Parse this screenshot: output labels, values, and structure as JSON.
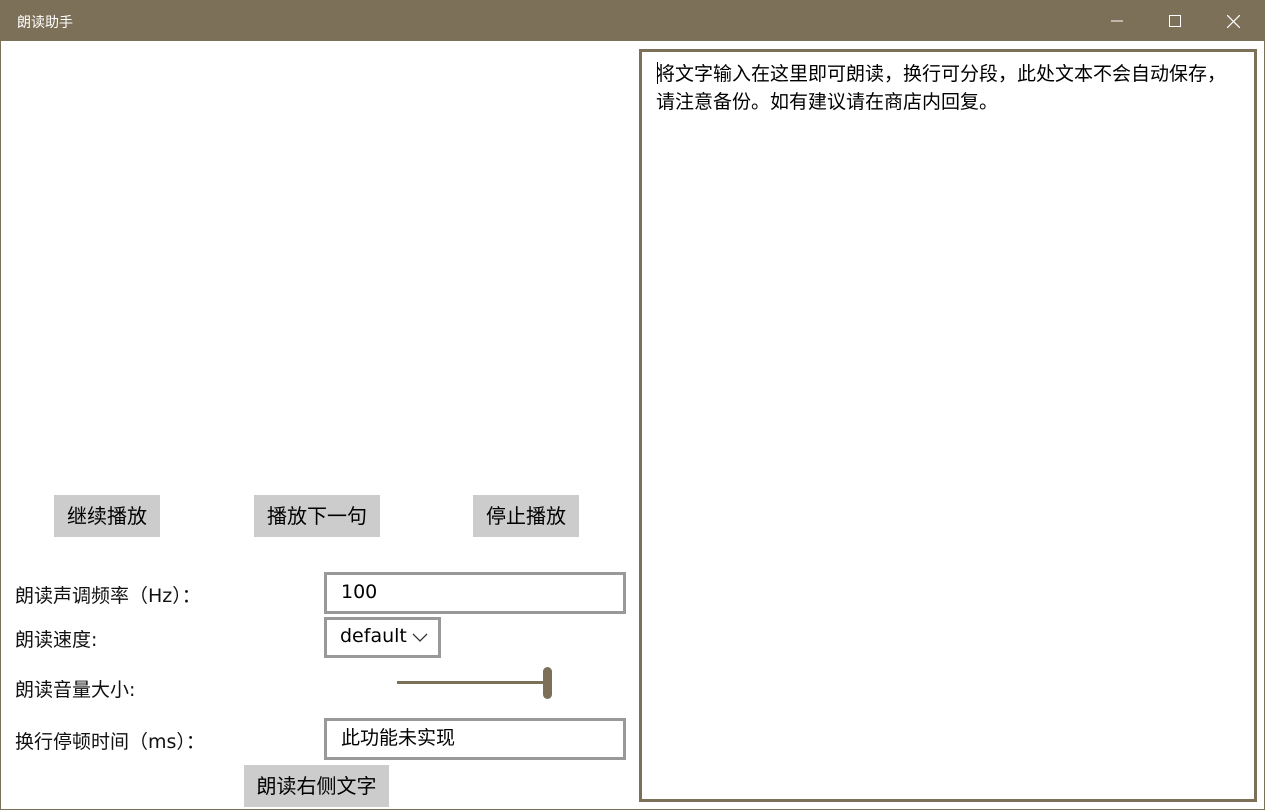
{
  "window": {
    "title": "朗读助手",
    "controls": {
      "minimize_icon": "minimize-icon",
      "maximize_icon": "maximize-icon",
      "close_icon": "close-icon"
    },
    "accent_color": "#7d7058"
  },
  "playback": {
    "continue_label": "继续播放",
    "next_label": "播放下一句",
    "stop_label": "停止播放"
  },
  "settings": {
    "pitch_label": "朗读声调频率（Hz）：",
    "pitch_value": "100",
    "speed_label": "朗读速度:",
    "speed_selected": "default",
    "volume_label": "朗读音量大小:",
    "volume_level_fraction": 1.0,
    "pause_label": "换行停顿时间（ms）：",
    "pause_value": "此功能未实现"
  },
  "read_button_label": "朗读右侧文字",
  "editor": {
    "text": "将文字输入在这里即可朗读，换行可分段，此处文本不会自动保存，请注意备份。如有建议请在商店内回复。"
  }
}
